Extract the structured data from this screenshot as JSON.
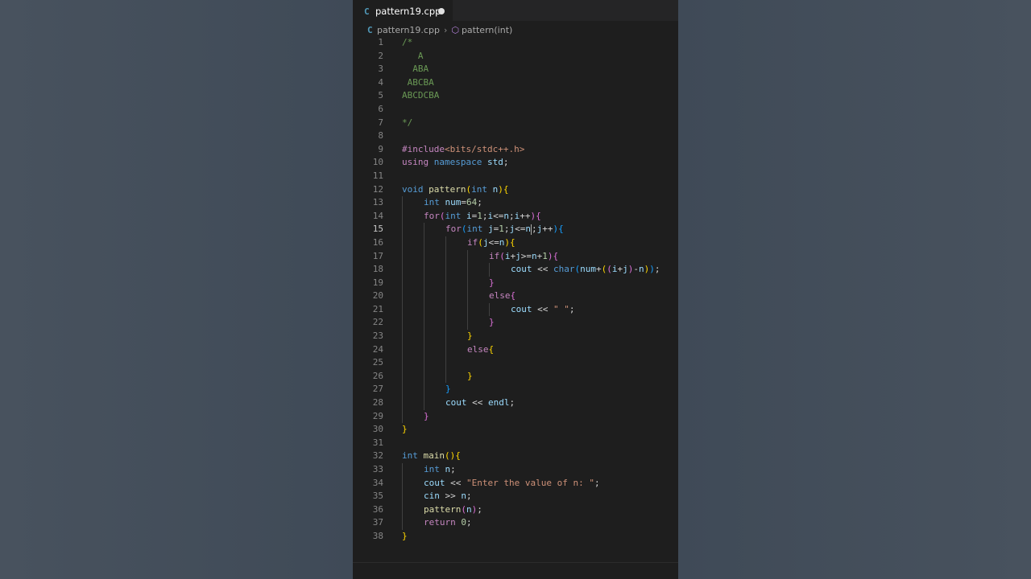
{
  "tab": {
    "filename": "pattern19.cpp",
    "icon": "C",
    "modified": true
  },
  "breadcrumb": {
    "file": "pattern19.cpp",
    "symbol": "pattern(int)"
  },
  "active_line": 15,
  "lines": [
    {
      "no": "1",
      "indent": 0,
      "tokens": [
        {
          "t": "/*",
          "c": "cm"
        }
      ]
    },
    {
      "no": "2",
      "indent": 0,
      "tokens": [
        {
          "t": "   A",
          "c": "cm"
        }
      ]
    },
    {
      "no": "3",
      "indent": 0,
      "tokens": [
        {
          "t": "  ABA",
          "c": "cm"
        }
      ]
    },
    {
      "no": "4",
      "indent": 0,
      "tokens": [
        {
          "t": " ABCBA",
          "c": "cm"
        }
      ]
    },
    {
      "no": "5",
      "indent": 0,
      "tokens": [
        {
          "t": "ABCDCBA",
          "c": "cm"
        }
      ]
    },
    {
      "no": "6",
      "indent": 0,
      "tokens": []
    },
    {
      "no": "7",
      "indent": 0,
      "tokens": [
        {
          "t": "*/",
          "c": "cm"
        }
      ]
    },
    {
      "no": "8",
      "indent": 0,
      "tokens": []
    },
    {
      "no": "9",
      "indent": 0,
      "tokens": [
        {
          "t": "#include",
          "c": "c"
        },
        {
          "t": "<bits/stdc++.h>",
          "c": "s"
        }
      ]
    },
    {
      "no": "10",
      "indent": 0,
      "tokens": [
        {
          "t": "using",
          "c": "c"
        },
        {
          "t": " ",
          "c": "p"
        },
        {
          "t": "namespace",
          "c": "k"
        },
        {
          "t": " std",
          "c": "v"
        },
        {
          "t": ";",
          "c": "p"
        }
      ]
    },
    {
      "no": "11",
      "indent": 0,
      "tokens": []
    },
    {
      "no": "12",
      "indent": 0,
      "tokens": [
        {
          "t": "void",
          "c": "k"
        },
        {
          "t": " ",
          "c": "p"
        },
        {
          "t": "pattern",
          "c": "f"
        },
        {
          "t": "(",
          "c": "b1"
        },
        {
          "t": "int",
          "c": "k"
        },
        {
          "t": " n",
          "c": "v"
        },
        {
          "t": "){",
          "c": "b1"
        }
      ]
    },
    {
      "no": "13",
      "indent": 1,
      "tokens": [
        {
          "t": "int",
          "c": "k"
        },
        {
          "t": " num",
          "c": "v"
        },
        {
          "t": "=",
          "c": "p"
        },
        {
          "t": "64",
          "c": "n"
        },
        {
          "t": ";",
          "c": "p"
        }
      ]
    },
    {
      "no": "14",
      "indent": 1,
      "tokens": [
        {
          "t": "for",
          "c": "c"
        },
        {
          "t": "(",
          "c": "b2"
        },
        {
          "t": "int",
          "c": "k"
        },
        {
          "t": " i",
          "c": "v"
        },
        {
          "t": "=",
          "c": "p"
        },
        {
          "t": "1",
          "c": "n"
        },
        {
          "t": ";",
          "c": "p"
        },
        {
          "t": "i",
          "c": "v"
        },
        {
          "t": "<=",
          "c": "p"
        },
        {
          "t": "n",
          "c": "v"
        },
        {
          "t": ";",
          "c": "p"
        },
        {
          "t": "i",
          "c": "v"
        },
        {
          "t": "++",
          "c": "p"
        },
        {
          "t": "){",
          "c": "b2"
        }
      ]
    },
    {
      "no": "15",
      "indent": 2,
      "tokens": [
        {
          "t": "for",
          "c": "c"
        },
        {
          "t": "(",
          "c": "b3"
        },
        {
          "t": "int",
          "c": "k"
        },
        {
          "t": " j",
          "c": "v"
        },
        {
          "t": "=",
          "c": "p"
        },
        {
          "t": "1",
          "c": "n"
        },
        {
          "t": ";",
          "c": "p"
        },
        {
          "t": "j",
          "c": "v"
        },
        {
          "t": "<=",
          "c": "p"
        },
        {
          "t": "n",
          "c": "v"
        },
        {
          "t": "CURSOR",
          "c": "cursor"
        },
        {
          "t": ";",
          "c": "p"
        },
        {
          "t": "j",
          "c": "v"
        },
        {
          "t": "++",
          "c": "p"
        },
        {
          "t": "){",
          "c": "b3"
        }
      ]
    },
    {
      "no": "16",
      "indent": 3,
      "tokens": [
        {
          "t": "if",
          "c": "c"
        },
        {
          "t": "(",
          "c": "b1"
        },
        {
          "t": "j",
          "c": "v"
        },
        {
          "t": "<=",
          "c": "p"
        },
        {
          "t": "n",
          "c": "v"
        },
        {
          "t": "){",
          "c": "b1"
        }
      ]
    },
    {
      "no": "17",
      "indent": 4,
      "tokens": [
        {
          "t": "if",
          "c": "c"
        },
        {
          "t": "(",
          "c": "b2"
        },
        {
          "t": "i",
          "c": "v"
        },
        {
          "t": "+",
          "c": "p"
        },
        {
          "t": "j",
          "c": "v"
        },
        {
          "t": ">=",
          "c": "p"
        },
        {
          "t": "n",
          "c": "v"
        },
        {
          "t": "+",
          "c": "p"
        },
        {
          "t": "1",
          "c": "n"
        },
        {
          "t": "){",
          "c": "b2"
        }
      ]
    },
    {
      "no": "18",
      "indent": 5,
      "tokens": [
        {
          "t": "cout",
          "c": "v"
        },
        {
          "t": " << ",
          "c": "p"
        },
        {
          "t": "char",
          "c": "k"
        },
        {
          "t": "(",
          "c": "b3"
        },
        {
          "t": "num",
          "c": "v"
        },
        {
          "t": "+",
          "c": "p"
        },
        {
          "t": "(",
          "c": "b1"
        },
        {
          "t": "(",
          "c": "b2"
        },
        {
          "t": "i",
          "c": "v"
        },
        {
          "t": "+",
          "c": "p"
        },
        {
          "t": "j",
          "c": "v"
        },
        {
          "t": ")",
          "c": "b2"
        },
        {
          "t": "-",
          "c": "p"
        },
        {
          "t": "n",
          "c": "v"
        },
        {
          "t": ")",
          "c": "b1"
        },
        {
          "t": ")",
          "c": "b3"
        },
        {
          "t": ";",
          "c": "p"
        }
      ]
    },
    {
      "no": "19",
      "indent": 4,
      "tokens": [
        {
          "t": "}",
          "c": "b2"
        }
      ]
    },
    {
      "no": "20",
      "indent": 4,
      "tokens": [
        {
          "t": "else",
          "c": "c"
        },
        {
          "t": "{",
          "c": "b2"
        }
      ]
    },
    {
      "no": "21",
      "indent": 5,
      "tokens": [
        {
          "t": "cout",
          "c": "v"
        },
        {
          "t": " << ",
          "c": "p"
        },
        {
          "t": "\" \"",
          "c": "s"
        },
        {
          "t": ";",
          "c": "p"
        }
      ]
    },
    {
      "no": "22",
      "indent": 4,
      "tokens": [
        {
          "t": "}",
          "c": "b2"
        }
      ]
    },
    {
      "no": "23",
      "indent": 3,
      "tokens": [
        {
          "t": "}",
          "c": "b1"
        }
      ]
    },
    {
      "no": "24",
      "indent": 3,
      "tokens": [
        {
          "t": "else",
          "c": "c"
        },
        {
          "t": "{",
          "c": "b1"
        }
      ]
    },
    {
      "no": "25",
      "indent": 3,
      "tokens": []
    },
    {
      "no": "26",
      "indent": 3,
      "tokens": [
        {
          "t": "}",
          "c": "b1"
        }
      ]
    },
    {
      "no": "27",
      "indent": 2,
      "tokens": [
        {
          "t": "}",
          "c": "b3"
        }
      ]
    },
    {
      "no": "28",
      "indent": 2,
      "tokens": [
        {
          "t": "cout",
          "c": "v"
        },
        {
          "t": " << ",
          "c": "p"
        },
        {
          "t": "endl",
          "c": "v"
        },
        {
          "t": ";",
          "c": "p"
        }
      ]
    },
    {
      "no": "29",
      "indent": 1,
      "tokens": [
        {
          "t": "}",
          "c": "b2"
        }
      ]
    },
    {
      "no": "30",
      "indent": 0,
      "tokens": [
        {
          "t": "}",
          "c": "b1"
        }
      ]
    },
    {
      "no": "31",
      "indent": 0,
      "tokens": []
    },
    {
      "no": "32",
      "indent": 0,
      "tokens": [
        {
          "t": "int",
          "c": "k"
        },
        {
          "t": " ",
          "c": "p"
        },
        {
          "t": "main",
          "c": "f"
        },
        {
          "t": "(){",
          "c": "b1"
        }
      ]
    },
    {
      "no": "33",
      "indent": 1,
      "tokens": [
        {
          "t": "int",
          "c": "k"
        },
        {
          "t": " n",
          "c": "v"
        },
        {
          "t": ";",
          "c": "p"
        }
      ]
    },
    {
      "no": "34",
      "indent": 1,
      "tokens": [
        {
          "t": "cout",
          "c": "v"
        },
        {
          "t": " << ",
          "c": "p"
        },
        {
          "t": "\"Enter the value of n: \"",
          "c": "s"
        },
        {
          "t": ";",
          "c": "p"
        }
      ]
    },
    {
      "no": "35",
      "indent": 1,
      "tokens": [
        {
          "t": "cin",
          "c": "v"
        },
        {
          "t": " >> ",
          "c": "p"
        },
        {
          "t": "n",
          "c": "v"
        },
        {
          "t": ";",
          "c": "p"
        }
      ]
    },
    {
      "no": "36",
      "indent": 1,
      "tokens": [
        {
          "t": "pattern",
          "c": "f"
        },
        {
          "t": "(",
          "c": "b2"
        },
        {
          "t": "n",
          "c": "v"
        },
        {
          "t": ")",
          "c": "b2"
        },
        {
          "t": ";",
          "c": "p"
        }
      ]
    },
    {
      "no": "37",
      "indent": 1,
      "tokens": [
        {
          "t": "return",
          "c": "c"
        },
        {
          "t": " ",
          "c": "p"
        },
        {
          "t": "0",
          "c": "n"
        },
        {
          "t": ";",
          "c": "p"
        }
      ]
    },
    {
      "no": "38",
      "indent": 0,
      "tokens": [
        {
          "t": "}",
          "c": "b1"
        }
      ]
    }
  ]
}
